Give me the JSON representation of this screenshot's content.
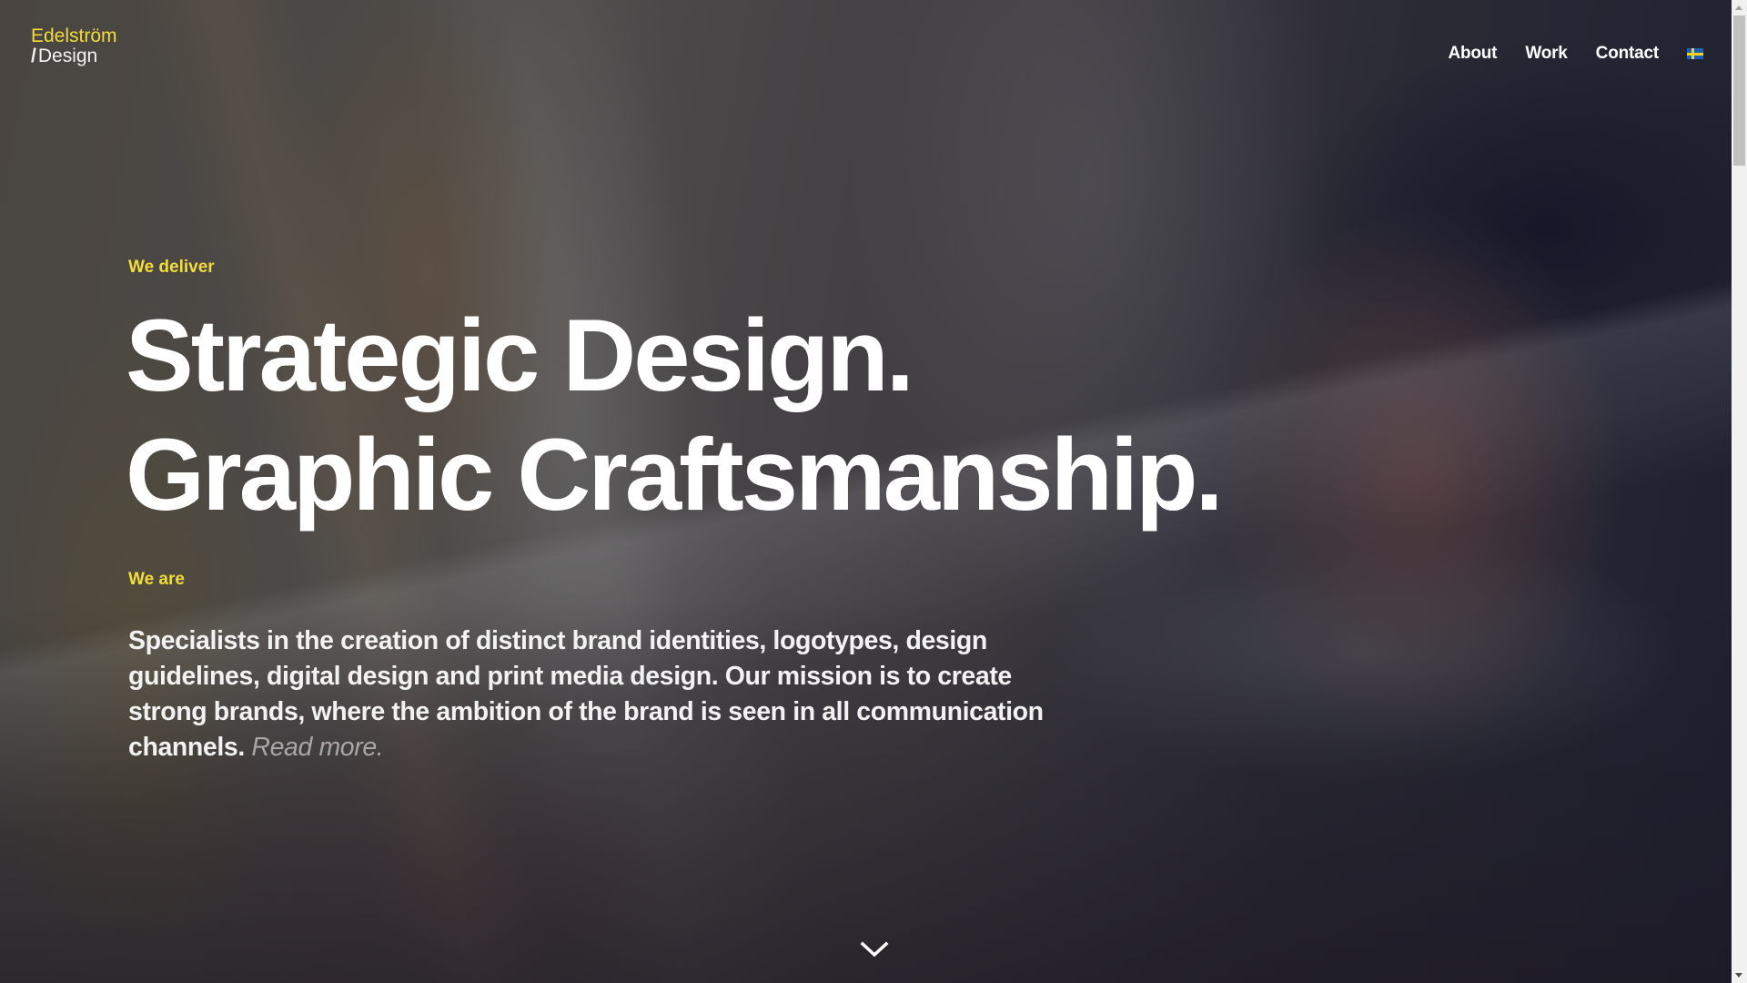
{
  "brand": {
    "line1": "Edelström",
    "slash": "/",
    "line2": "Design",
    "accent_color": "#f2dc3a"
  },
  "nav": {
    "items": [
      {
        "label": "About"
      },
      {
        "label": "Work"
      },
      {
        "label": "Contact"
      }
    ],
    "language_icon": "swedish-flag-icon"
  },
  "hero": {
    "eyebrow_1": "We deliver",
    "headline_line1": "Strategic Design.",
    "headline_line2": "Graphic Craftsmanship.",
    "eyebrow_2": "We are",
    "body": "Specialists in the creation of distinct brand identities, logotypes, design guidelines, digital design and print media design. Our mission is to create strong brands, where the ambition of the brand is seen in all communication channels.",
    "read_more": "Read more.",
    "scroll_icon": "chevron-down-icon"
  }
}
